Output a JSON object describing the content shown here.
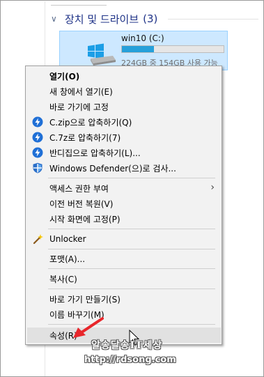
{
  "group": {
    "label": "장치 및 드라이브",
    "count": "(3)"
  },
  "drive": {
    "name": "win10 (C:)",
    "info": "224GB 중 154GB 사용 가능",
    "used_fraction": 0.3125,
    "bar_color": "#26a0da"
  },
  "menu": {
    "open": "열기(O)",
    "open_new_window": "새 창에서 열기(E)",
    "pin_quick_access": "바로 가기에 고정",
    "zip": "C.zip으로 압축하기(Q)",
    "sevenz": "C.7z로 압축하기(7)",
    "bandizip": "반디집으로 압축하기(L)...",
    "defender": "Windows Defender(으)로 검사...",
    "give_access": "액세스 권한 부여",
    "restore": "이전 버전 복원(V)",
    "pin_start": "시작 화면에 고정(P)",
    "unlocker": "Unlocker",
    "format": "포맷(A)...",
    "copy": "복사(C)",
    "create_shortcut": "바로 가기 만들기(S)",
    "rename": "이름 바꾸기(M)",
    "properties": "속성(R)"
  },
  "icons": {
    "bandizip": "bandizip-icon",
    "defender": "shield-icon",
    "unlocker": "wand-icon",
    "drive": "windows-drive-icon"
  },
  "watermark": {
    "line1": "알송달송IT세상",
    "line2": "http://rdsong.com"
  }
}
